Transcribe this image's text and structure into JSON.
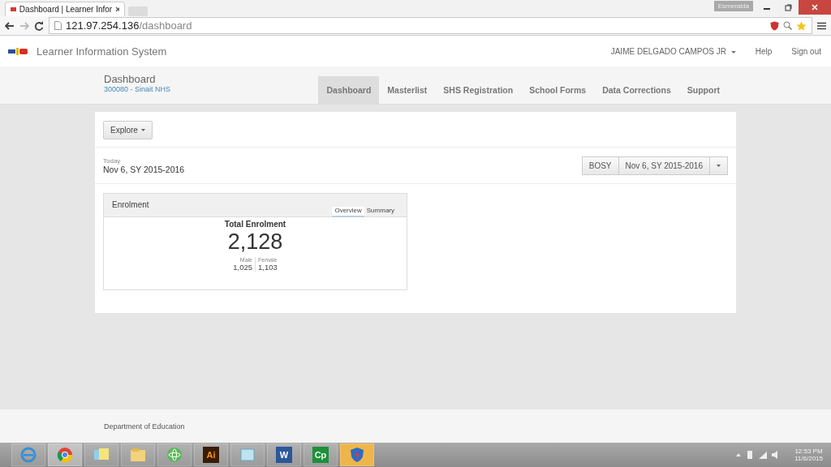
{
  "browser": {
    "tab_title": "Dashboard | Learner Infor",
    "url_host": "121.97.254.136",
    "url_path": "/dashboard",
    "profile": "Esmeralda"
  },
  "app": {
    "title": "Learner Information System",
    "user": "JAIME DELGADO CAMPOS JR",
    "links": [
      "Help",
      "Sign out"
    ]
  },
  "page_header": {
    "title": "Dashboard",
    "subtitle": "300080 - Sinait NHS"
  },
  "nav": [
    {
      "label": "Dashboard",
      "selected": true
    },
    {
      "label": "Masterlist",
      "selected": false
    },
    {
      "label": "SHS Registration",
      "selected": false
    },
    {
      "label": "School Forms",
      "selected": false
    },
    {
      "label": "Data Corrections",
      "selected": false
    },
    {
      "label": "Support",
      "selected": false
    }
  ],
  "toolbar": {
    "explore": "Explore"
  },
  "today": {
    "label": "Today",
    "value": "Nov 6, SY 2015-2016"
  },
  "period": {
    "phase": "BOSY",
    "date": "Nov 6, SY 2015-2016"
  },
  "enrolment": {
    "title": "Enrolment",
    "tabs": [
      {
        "label": "Overview",
        "selected": true
      },
      {
        "label": "Summary",
        "selected": false
      }
    ],
    "total_label": "Total Enrolment",
    "total": "2,128",
    "breakdown": [
      {
        "label": "Male",
        "value": "1,025"
      },
      {
        "label": "Female",
        "value": "1,103"
      }
    ]
  },
  "footer": "Department of Education",
  "taskbar": {
    "apps": [
      {
        "kind": "ie",
        "selected": false
      },
      {
        "kind": "chrome",
        "selected": true
      },
      {
        "kind": "notes",
        "selected": false
      },
      {
        "kind": "folder",
        "selected": false
      },
      {
        "kind": "atom",
        "selected": false
      },
      {
        "kind": "ai",
        "label": "Ai",
        "selected": false
      },
      {
        "kind": "viewer",
        "selected": false
      },
      {
        "kind": "word",
        "label": "W",
        "selected": false
      },
      {
        "kind": "cp",
        "label": "Cp",
        "selected": false
      },
      {
        "kind": "shield",
        "selected": false
      }
    ],
    "time": "12:53 PM",
    "date": "11/6/2015"
  }
}
